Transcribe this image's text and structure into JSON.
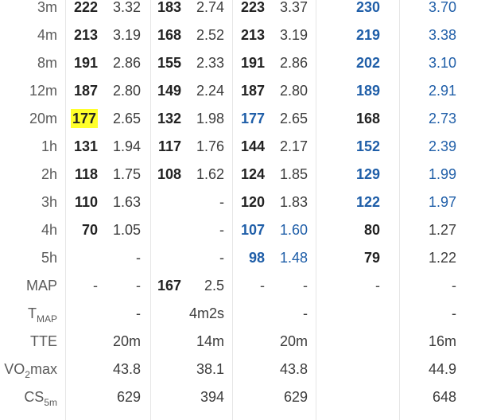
{
  "rows": [
    {
      "label": "3m",
      "c": [
        "222",
        "3.32",
        "183",
        "2.74",
        "223",
        "3.37",
        "230",
        "3.70"
      ]
    },
    {
      "label": "4m",
      "c": [
        "213",
        "3.19",
        "168",
        "2.52",
        "213",
        "3.19",
        "219",
        "3.38"
      ]
    },
    {
      "label": "8m",
      "c": [
        "191",
        "2.86",
        "155",
        "2.33",
        "191",
        "2.86",
        "202",
        "3.10"
      ]
    },
    {
      "label": "12m",
      "c": [
        "187",
        "2.80",
        "149",
        "2.24",
        "187",
        "2.80",
        "189",
        "2.91"
      ]
    },
    {
      "label": "20m",
      "c": [
        "177",
        "2.65",
        "132",
        "1.98",
        "177",
        "2.65",
        "168",
        "2.73"
      ]
    },
    {
      "label": "1h",
      "c": [
        "131",
        "1.94",
        "117",
        "1.76",
        "144",
        "2.17",
        "152",
        "2.39"
      ]
    },
    {
      "label": "2h",
      "c": [
        "118",
        "1.75",
        "108",
        "1.62",
        "124",
        "1.85",
        "129",
        "1.99"
      ]
    },
    {
      "label": "3h",
      "c": [
        "110",
        "1.63",
        "",
        "-",
        "120",
        "1.83",
        "122",
        "1.97"
      ]
    },
    {
      "label": "4h",
      "c": [
        "70",
        "1.05",
        "",
        "-",
        "107",
        "1.60",
        "80",
        "1.27"
      ]
    },
    {
      "label": "5h",
      "c": [
        "",
        "-",
        "",
        "-",
        "98",
        "1.48",
        "79",
        "1.22"
      ]
    },
    {
      "label": "MAP",
      "c": [
        "-",
        "-",
        "167",
        "2.5",
        "-",
        "-",
        "-",
        "-"
      ]
    }
  ],
  "summary": [
    {
      "label": "T",
      "label_sub": "MAP",
      "c": [
        "-",
        "4m2s",
        "-",
        "-"
      ]
    },
    {
      "label": "TTE",
      "label_sub": "",
      "c": [
        "20m",
        "14m",
        "20m",
        "16m"
      ]
    },
    {
      "label": "VO",
      "label_sub": "2",
      "label_suffix": "max",
      "c": [
        "43.8",
        "38.1",
        "43.8",
        "44.9"
      ]
    },
    {
      "label": "CS",
      "label_sub": "5m",
      "c": [
        "629",
        "394",
        "629",
        "648"
      ]
    }
  ],
  "highlight": {
    "row": "20m",
    "value": "177",
    "color": "#ffff2a"
  },
  "accent_blue": "#1f5ea8"
}
